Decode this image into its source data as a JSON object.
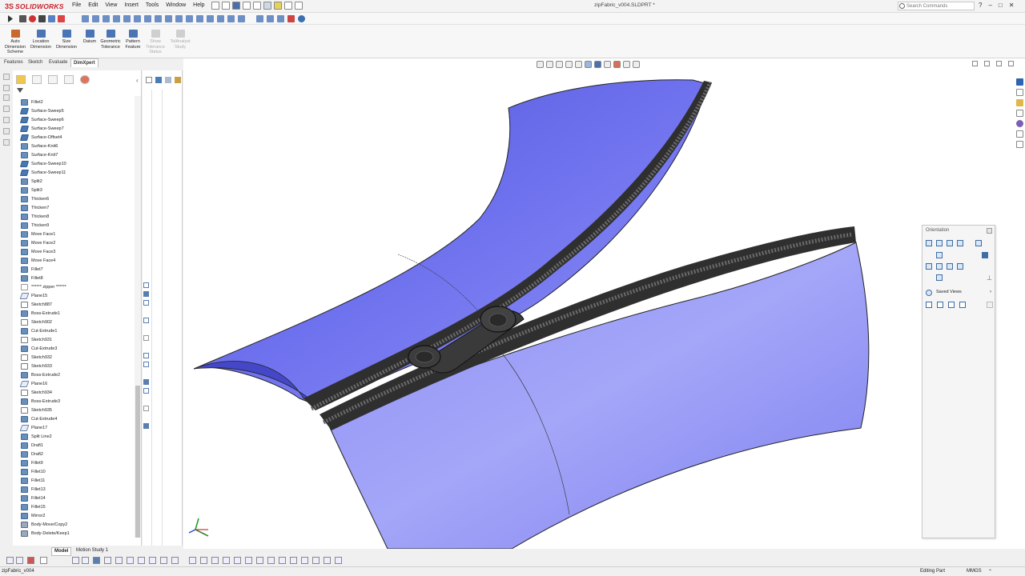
{
  "app": {
    "brand_ds": "3S",
    "brand_name": "SOLIDWORKS",
    "document_title": "zipFabric_v004.SLDPRT *"
  },
  "menu": [
    "File",
    "Edit",
    "View",
    "Insert",
    "Tools",
    "Window",
    "Help"
  ],
  "search": {
    "placeholder": "Search Commands"
  },
  "window_controls": {
    "help": "?",
    "minimize": "–",
    "restore": "□",
    "close": "✕"
  },
  "ribbon": {
    "buttons": [
      {
        "label": "Auto\nDimension\nScheme",
        "enabled": true
      },
      {
        "label": "Location\nDimension",
        "enabled": true
      },
      {
        "label": "Size\nDimension",
        "enabled": true
      },
      {
        "label": "Datum",
        "enabled": true
      },
      {
        "label": "Geometric\nTolerance",
        "enabled": true
      },
      {
        "label": "Pattern\nFeature",
        "enabled": true
      },
      {
        "label": "Show\nTolerance\nStatus",
        "enabled": false
      },
      {
        "label": "TolAnalyst\nStudy",
        "enabled": false
      }
    ]
  },
  "command_tabs": [
    "Features",
    "Sketch",
    "Evaluate",
    "DimXpert"
  ],
  "active_command_tab": "DimXpert",
  "feature_tree": [
    {
      "label": "Fillet2",
      "type": "feat"
    },
    {
      "label": "Surface-Sweep5",
      "type": "surf"
    },
    {
      "label": "Surface-Sweep6",
      "type": "surf"
    },
    {
      "label": "Surface-Sweep7",
      "type": "surf"
    },
    {
      "label": "Surface-Offset4",
      "type": "surf"
    },
    {
      "label": "Surface-Knit6",
      "type": "feat"
    },
    {
      "label": "Surface-Knit7",
      "type": "feat"
    },
    {
      "label": "Surface-Sweep10",
      "type": "surf"
    },
    {
      "label": "Surface-Sweep11",
      "type": "surf"
    },
    {
      "label": "Split2",
      "type": "feat"
    },
    {
      "label": "Split3",
      "type": "feat"
    },
    {
      "label": "Thicken6",
      "type": "feat"
    },
    {
      "label": "Thicken7",
      "type": "feat"
    },
    {
      "label": "Thicken8",
      "type": "feat"
    },
    {
      "label": "Thicken9",
      "type": "feat"
    },
    {
      "label": "Move Face1",
      "type": "feat"
    },
    {
      "label": "Move Face2",
      "type": "feat"
    },
    {
      "label": "Move Face3",
      "type": "feat"
    },
    {
      "label": "Move Face4",
      "type": "feat"
    },
    {
      "label": "Fillet7",
      "type": "feat"
    },
    {
      "label": "Fillet8",
      "type": "feat"
    },
    {
      "label": "****** zipper ******",
      "type": "folder"
    },
    {
      "label": "Plane15",
      "type": "plane"
    },
    {
      "label": "Sketch887",
      "type": "sketch"
    },
    {
      "label": "Boss-Extrude1",
      "type": "feat"
    },
    {
      "label": "Sketch902",
      "type": "sketch"
    },
    {
      "label": "Cut-Extrude1",
      "type": "feat"
    },
    {
      "label": "Sketch931",
      "type": "sketch"
    },
    {
      "label": "Cut-Extrude3",
      "type": "feat"
    },
    {
      "label": "Sketch932",
      "type": "sketch"
    },
    {
      "label": "Sketch933",
      "type": "sketch"
    },
    {
      "label": "Boss-Extrude2",
      "type": "feat"
    },
    {
      "label": "Plane16",
      "type": "plane"
    },
    {
      "label": "Sketch934",
      "type": "sketch"
    },
    {
      "label": "Boss-Extrude3",
      "type": "feat"
    },
    {
      "label": "Sketch935",
      "type": "sketch"
    },
    {
      "label": "Cut-Extrude4",
      "type": "feat"
    },
    {
      "label": "Plane17",
      "type": "plane"
    },
    {
      "label": "Split Line2",
      "type": "feat"
    },
    {
      "label": "Draft1",
      "type": "feat"
    },
    {
      "label": "Draft2",
      "type": "feat"
    },
    {
      "label": "Fillet9",
      "type": "feat"
    },
    {
      "label": "Fillet10",
      "type": "feat"
    },
    {
      "label": "Fillet11",
      "type": "feat"
    },
    {
      "label": "Fillet13",
      "type": "feat"
    },
    {
      "label": "Fillet14",
      "type": "feat"
    },
    {
      "label": "Fillet15",
      "type": "feat"
    },
    {
      "label": "Mirror2",
      "type": "feat"
    },
    {
      "label": "Body-Move/Copy2",
      "type": "body"
    },
    {
      "label": "Body-Delete/Keep1",
      "type": "body"
    }
  ],
  "bottom_tabs": [
    "Model",
    "Motion Study 1"
  ],
  "active_bottom_tab": "Model",
  "orientation_panel": {
    "title": "Orientation",
    "saved_views": "Saved Views"
  },
  "status": {
    "left": "zipFabric_v004",
    "mode": "Editing Part",
    "units": "MMGS"
  },
  "colors": {
    "fabric": "#7a7df2",
    "zipper": "#3a3a3a",
    "accent": "#c8202a"
  }
}
